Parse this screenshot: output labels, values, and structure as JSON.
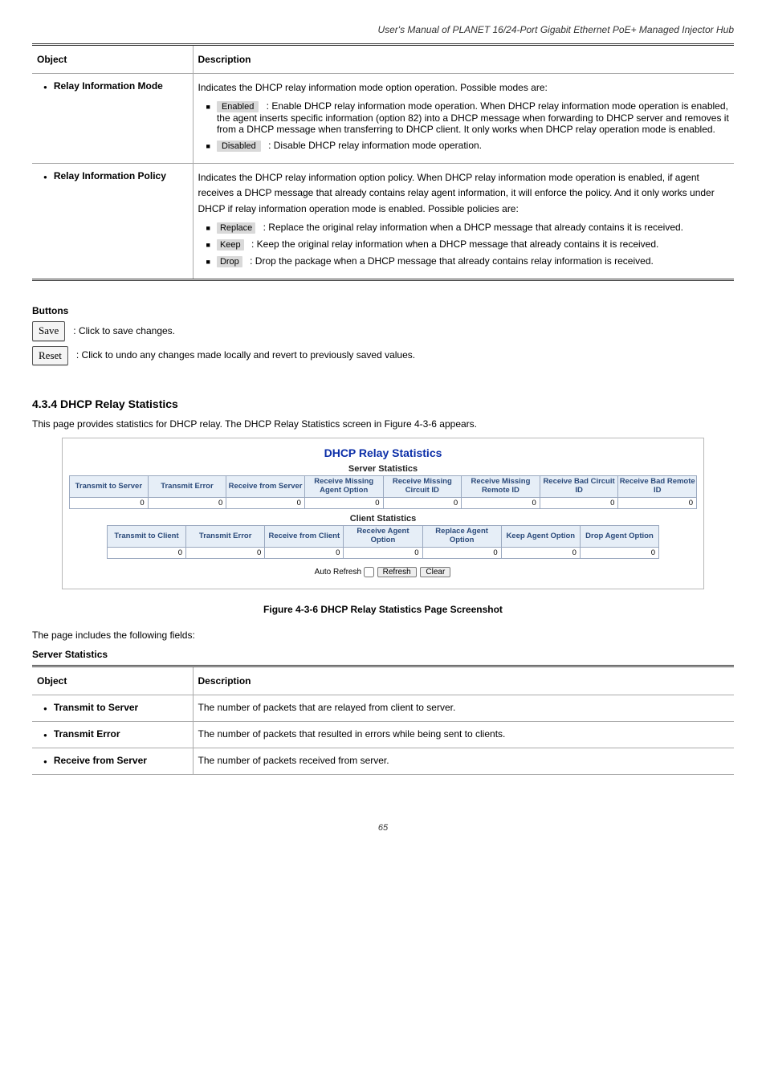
{
  "page_header": "User's Manual of PLANET 16/24-Port Gigabit Ethernet PoE+ Managed Injector Hub",
  "opt_table": {
    "head_obj": "Object",
    "head_desc": "Description",
    "rows": [
      {
        "obj": "Relay Information Mode",
        "desc": "Indicates the DHCP relay information mode option operation. Possible modes are:",
        "subs": [
          {
            "badge": "Enabled",
            "text": ": Enable DHCP relay information mode operation. When DHCP relay information mode operation is enabled, the agent inserts specific information (option 82) into a DHCP message when forwarding to DHCP server and removes it from a DHCP message when transferring to DHCP client. It only works when DHCP relay operation mode is enabled."
          },
          {
            "badge": "Disabled",
            "text": ": Disable DHCP relay information mode operation."
          }
        ]
      },
      {
        "obj": "Relay Information Policy",
        "desc": "Indicates the DHCP relay information option policy. When DHCP relay information mode operation is enabled, if agent receives a DHCP message that already contains relay agent information, it will enforce the policy. And it only works under DHCP if relay information operation mode is enabled. Possible policies are:",
        "subs": [
          {
            "badge": "Replace",
            "text": ": Replace the original relay information when a DHCP message that already contains it is received."
          },
          {
            "badge": "Keep",
            "text": ": Keep the original relay information when a DHCP message that already contains it is received."
          },
          {
            "badge": "Drop",
            "text": ": Drop the package when a DHCP message that already contains relay information is received."
          }
        ]
      }
    ]
  },
  "buttons_heading": "Buttons",
  "save_label": "Save",
  "save_desc": ": Click to save changes.",
  "reset_label": "Reset",
  "reset_desc": ": Click to undo any changes made locally and revert to previously saved values.",
  "stat_section_heading": "4.3.4 DHCP Relay Statistics",
  "stat_intro": "This page provides statistics for DHCP relay. The DHCP Relay Statistics screen in Figure 4-3-6 appears.",
  "shot": {
    "h1": "DHCP Relay Statistics",
    "sub1": "Server Statistics",
    "server_headers": [
      "Transmit to Server",
      "Transmit Error",
      "Receive from Server",
      "Receive Missing Agent Option",
      "Receive Missing Circuit ID",
      "Receive Missing Remote ID",
      "Receive Bad Circuit ID",
      "Receive Bad Remote ID"
    ],
    "server_values": [
      "0",
      "0",
      "0",
      "0",
      "0",
      "0",
      "0",
      "0"
    ],
    "sub2": "Client Statistics",
    "client_headers": [
      "Transmit to Client",
      "Transmit Error",
      "Receive from Client",
      "Receive Agent Option",
      "Replace Agent Option",
      "Keep Agent Option",
      "Drop Agent Option"
    ],
    "client_values": [
      "0",
      "0",
      "0",
      "0",
      "0",
      "0",
      "0"
    ],
    "auto_refresh_label": "Auto Refresh",
    "refresh_btn": "Refresh",
    "clear_btn": "Clear"
  },
  "figure_caption": "Figure 4-3-6 DHCP Relay Statistics Page Screenshot",
  "after_fig": "The page includes the following fields:",
  "server_stats_heading": "Server Statistics",
  "def_table": {
    "head_obj": "Object",
    "head_desc": "Description",
    "rows": [
      {
        "obj": "Transmit to Server",
        "desc": "The number of packets that are relayed from client to server."
      },
      {
        "obj": "Transmit Error",
        "desc": "The number of packets that resulted in errors while being sent to clients."
      },
      {
        "obj": "Receive from Server",
        "desc": "The number of packets received from server."
      }
    ]
  },
  "footer": "65"
}
